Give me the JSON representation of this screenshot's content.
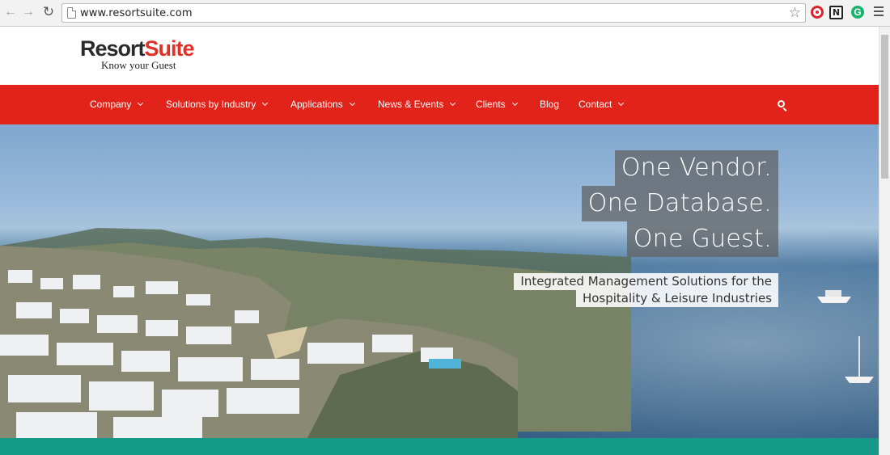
{
  "browser": {
    "url": "www.resortsuite.com",
    "icons": [
      "back-icon",
      "forward-icon",
      "reload-icon",
      "page-icon",
      "bookmark-star-icon",
      "extension-record-icon",
      "extension-n-icon",
      "extension-grammarly-icon",
      "menu-icon"
    ],
    "ext_n_label": "N",
    "ext_g_label": "G"
  },
  "brand": {
    "name_part1": "Resort",
    "name_part2": "Suite",
    "tagline": "Know your Guest",
    "colors": {
      "dark": "#2b2b2b",
      "red": "#e03126"
    }
  },
  "nav": {
    "items": [
      {
        "label": "Company",
        "has_dropdown": true
      },
      {
        "label": "Solutions by Industry",
        "has_dropdown": true
      },
      {
        "label": "Applications",
        "has_dropdown": true
      },
      {
        "label": "News & Events",
        "has_dropdown": true
      },
      {
        "label": "Clients",
        "has_dropdown": true
      },
      {
        "label": "Blog",
        "has_dropdown": false
      },
      {
        "label": "Contact",
        "has_dropdown": true
      }
    ],
    "search_icon": "search-icon",
    "background": "#e2231a"
  },
  "hero": {
    "headline": [
      "One Vendor.",
      "One Database.",
      "One Guest."
    ],
    "subheadline": [
      "Integrated Management Solutions for the",
      "Hospitality & Leisure Industries"
    ]
  },
  "colors": {
    "teal_bar": "#159a89"
  }
}
